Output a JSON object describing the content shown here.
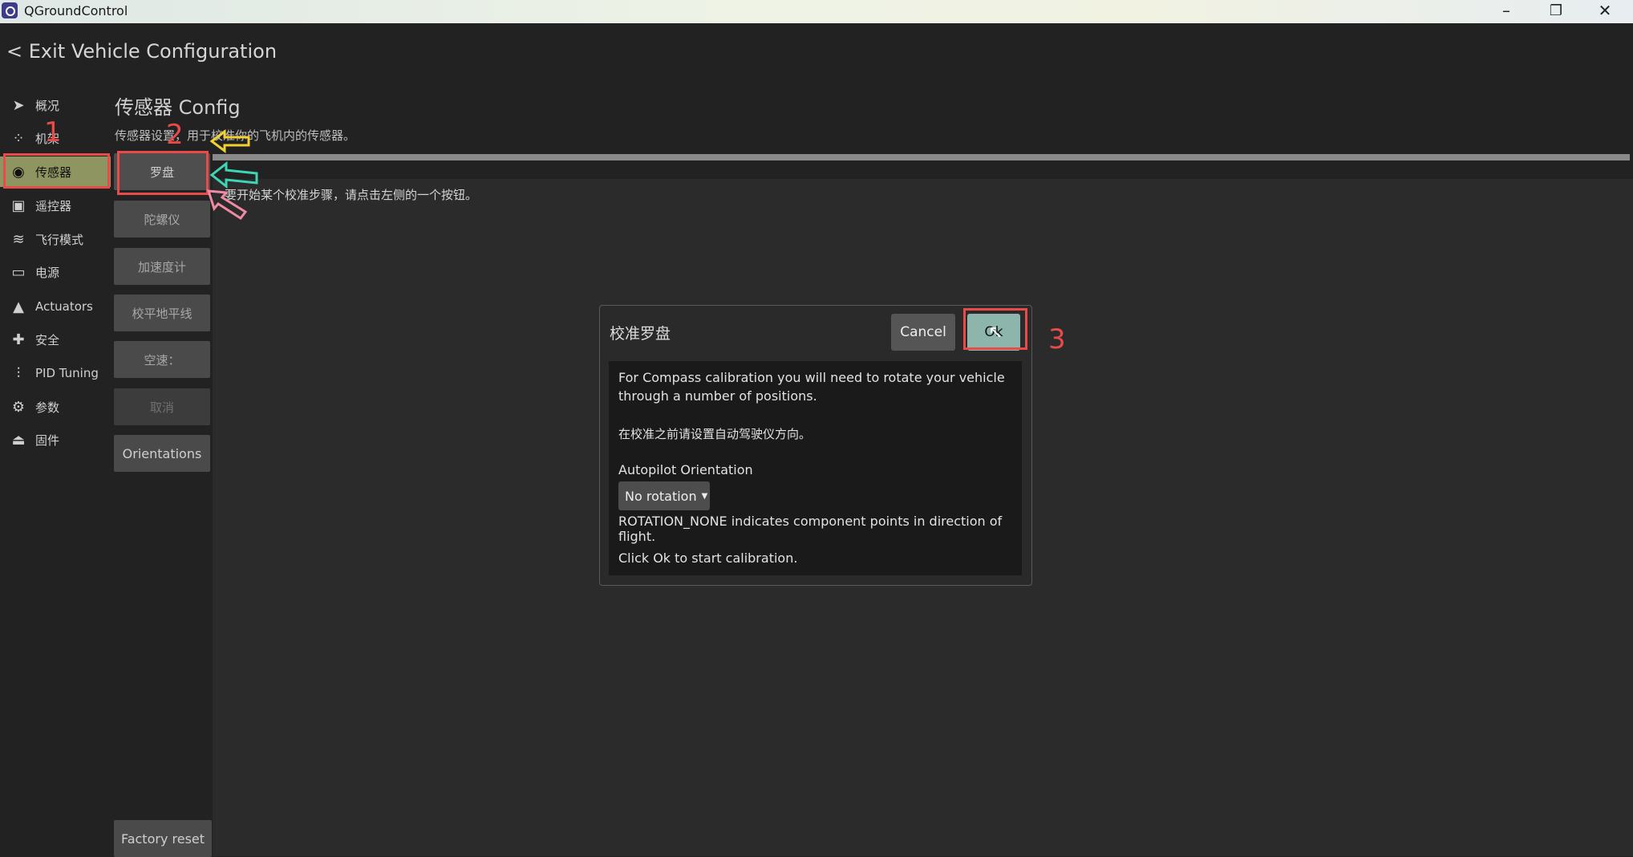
{
  "window": {
    "title": "QGroundControl",
    "minimize": "–",
    "restore": "❐",
    "close": "✕"
  },
  "header": {
    "back": "< Exit Vehicle Configuration"
  },
  "sidebar": {
    "items": [
      {
        "label": "概况",
        "icon": "plane-icon"
      },
      {
        "label": "机架",
        "icon": "airframe-icon"
      },
      {
        "label": "传感器",
        "icon": "sensors-icon"
      },
      {
        "label": "遥控器",
        "icon": "radio-icon"
      },
      {
        "label": "飞行模式",
        "icon": "flight-modes-icon"
      },
      {
        "label": "电源",
        "icon": "battery-icon"
      },
      {
        "label": "Actuators",
        "icon": "actuators-icon"
      },
      {
        "label": "安全",
        "icon": "safety-icon"
      },
      {
        "label": "PID Tuning",
        "icon": "sliders-icon"
      },
      {
        "label": "参数",
        "icon": "parameters-icon"
      },
      {
        "label": "固件",
        "icon": "firmware-icon"
      }
    ]
  },
  "page": {
    "title": "传感器 Config",
    "description": "传感器设置，用于校准你的飞机内的传感器。",
    "hint": "要开始某个校准步骤，请点击左侧的一个按钮。"
  },
  "sensor_buttons": [
    "罗盘",
    "陀螺仪",
    "加速度计",
    "校平地平线",
    "空速：",
    "取消",
    "Orientations"
  ],
  "factory_reset": "Factory reset",
  "dialog": {
    "title": "校准罗盘",
    "cancel": "Cancel",
    "ok": "Ok",
    "line1": "For Compass calibration you will need to rotate your vehicle",
    "line2": "through a number of positions.",
    "line3": "在校准之前请设置自动驾驶仪方向。",
    "orientation_label": "Autopilot Orientation",
    "orientation_value": "No rotation",
    "rotation_note": "ROTATION_NONE indicates component points in direction of flight.",
    "start_note": "Click Ok to start calibration."
  },
  "annotations": {
    "step1": "1",
    "step2": "2",
    "step3": "3",
    "highlight_color": "#e94a4a"
  }
}
